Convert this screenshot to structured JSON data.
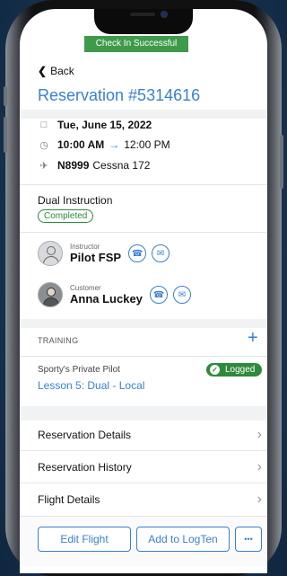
{
  "toast": "Check In Successful",
  "nav": {
    "back_label": "Back"
  },
  "reservation": {
    "title": "Reservation #5314616",
    "date": "Tue, June 15, 2022",
    "start_time": "10:00 AM",
    "end_time": "12:00 PM",
    "tail_number": "N8999",
    "aircraft": "Cessna 172",
    "type": "Dual Instruction",
    "status": "Completed"
  },
  "people": {
    "instructor": {
      "role": "Instructor",
      "name": "Pilot FSP"
    },
    "customer": {
      "role": "Customer",
      "name": "Anna Luckey"
    }
  },
  "training": {
    "section_label": "TRAINING",
    "add_label": "+",
    "course": "Sporty's Private Pilot",
    "lesson": "Lesson 5: Dual - Local",
    "status": "Logged"
  },
  "menu": [
    {
      "label": "Reservation Details"
    },
    {
      "label": "Reservation History"
    },
    {
      "label": "Flight Details"
    }
  ],
  "actions": {
    "edit_flight": "Edit Flight",
    "add_logten": "Add to LogTen",
    "more": "•••"
  },
  "icons": {
    "calendar": "calendar-icon",
    "clock": "clock-icon",
    "plane": "plane-icon",
    "phone": "phone-icon",
    "chat": "chat-icon"
  },
  "colors": {
    "accent": "#3a7fd5",
    "success": "#2f8a3c"
  }
}
